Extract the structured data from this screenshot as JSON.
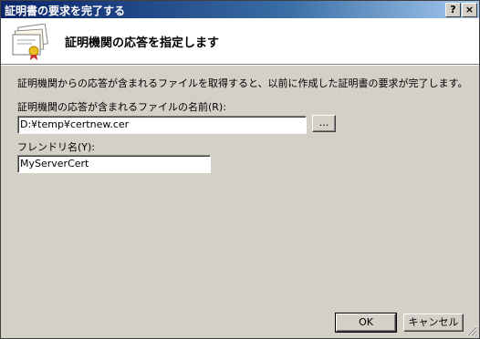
{
  "window": {
    "title": "証明書の要求を完了する",
    "help_label": "?",
    "close_label": "×"
  },
  "header": {
    "title": "証明機関の応答を指定します",
    "icon": "certificate-icon"
  },
  "body": {
    "description": "証明機関からの応答が含まれるファイルを取得すると、以前に作成した証明書の要求が完了します。",
    "file_label": "証明機関の応答が含まれるファイルの名前(R):",
    "file_value": "D:¥temp¥certnew.cer",
    "browse_label": "...",
    "friendly_label": "フレンドリ名(Y):",
    "friendly_value": "MyServerCert"
  },
  "footer": {
    "ok_label": "OK",
    "cancel_label": "キャンセル"
  }
}
